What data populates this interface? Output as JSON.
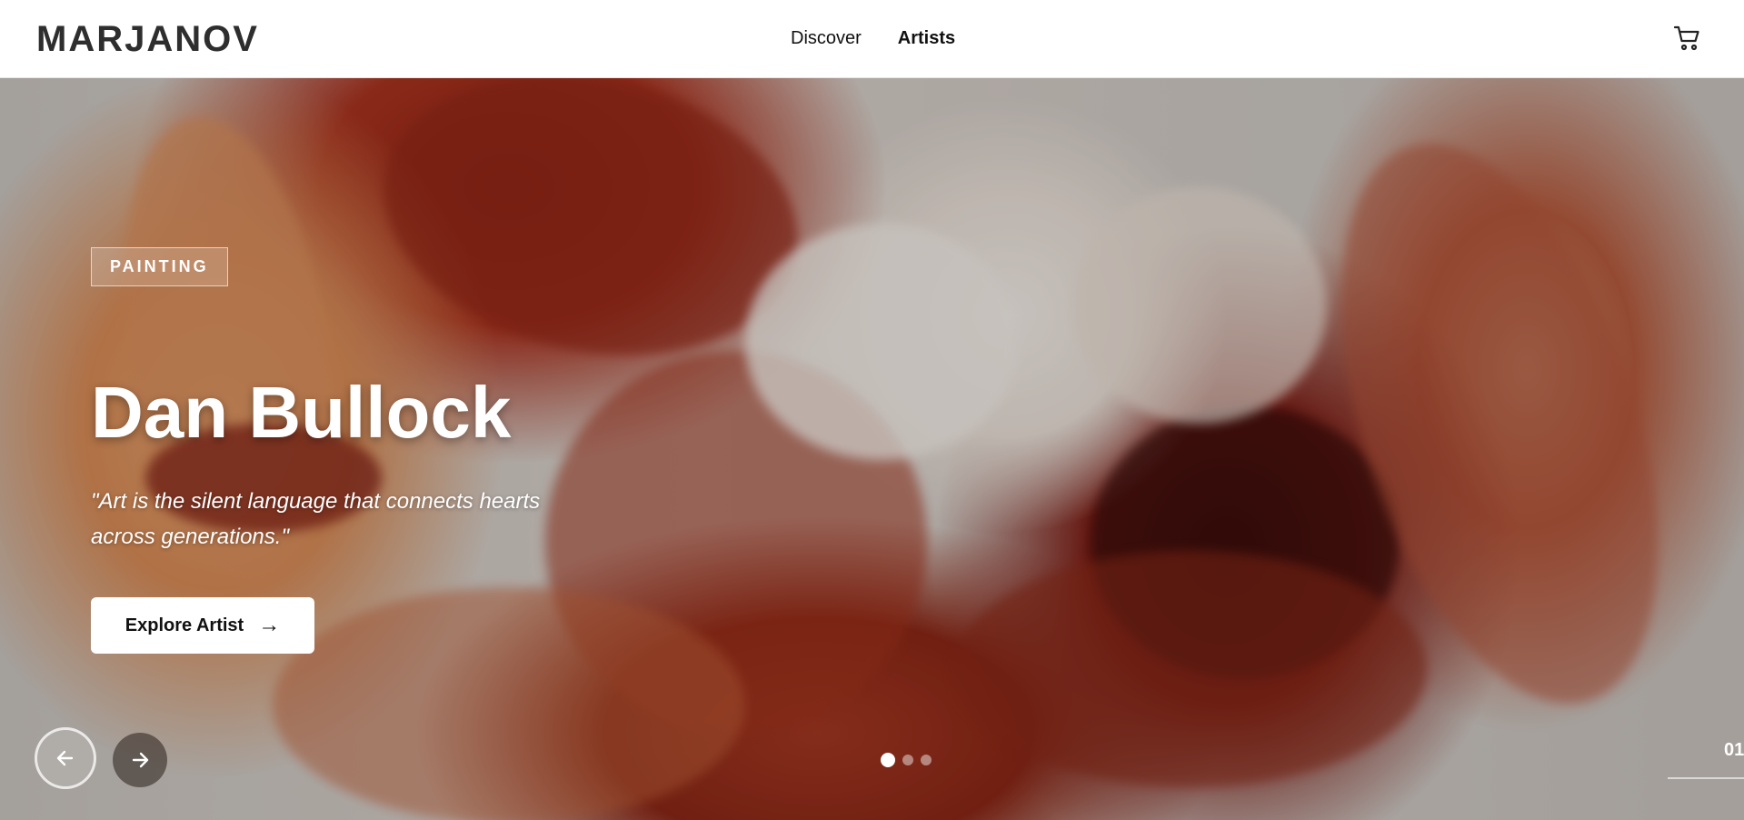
{
  "header": {
    "brand": "MARJANOV",
    "nav": [
      {
        "label": "Discover",
        "active": false
      },
      {
        "label": "Artists",
        "active": true
      }
    ],
    "cart_icon": "shopping-cart-icon"
  },
  "hero": {
    "category": "PAINTING",
    "artist_name": "Dan Bullock",
    "quote": "\"Art is the silent language that connects hearts across generations.\"",
    "cta_label": "Explore Artist",
    "cta_arrow": "→",
    "prev_icon": "arrow-left-icon",
    "next_icon": "arrow-right-icon",
    "slide_count": 3,
    "active_slide": 1,
    "counter": "01"
  },
  "colors": {
    "accent_white": "#ffffff",
    "brand_text": "#2e2e2e"
  }
}
